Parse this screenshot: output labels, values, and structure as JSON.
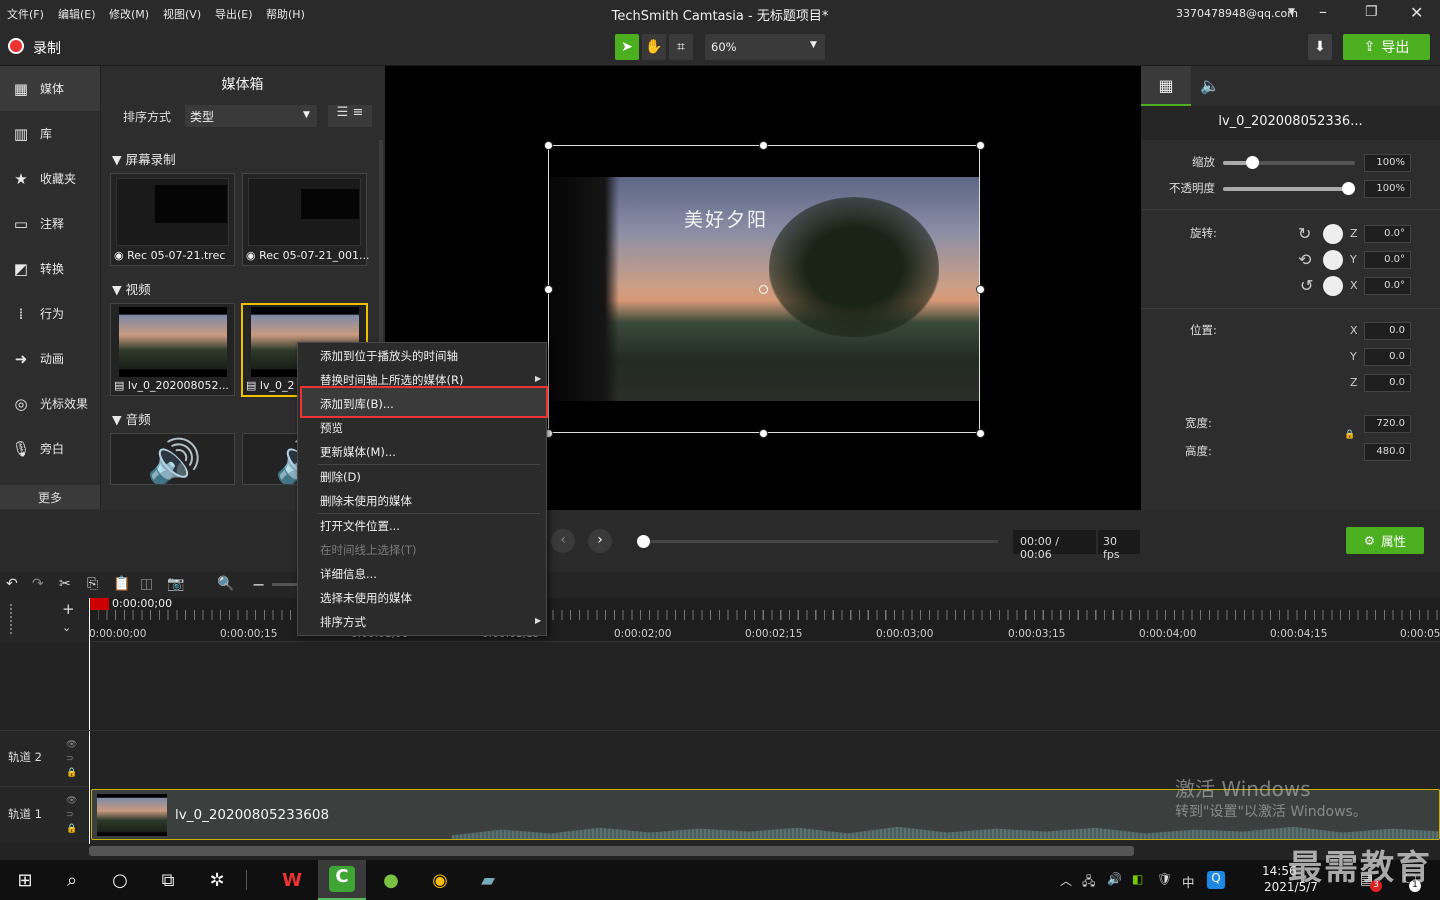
{
  "menubar": [
    "文件(F)",
    "编辑(E)",
    "修改(M)",
    "视图(V)",
    "导出(E)",
    "帮助(H)"
  ],
  "app_title": "TechSmith Camtasia - 无标题项目*",
  "account": "3370478948@qq.com",
  "toolbar": {
    "record_label": "录制",
    "zoom": "60%",
    "export_label": "导出"
  },
  "nav": [
    {
      "label": "媒体",
      "icon": "film-icon"
    },
    {
      "label": "库",
      "icon": "library-icon"
    },
    {
      "label": "收藏夹",
      "icon": "star-icon"
    },
    {
      "label": "注释",
      "icon": "annotation-icon"
    },
    {
      "label": "转换",
      "icon": "transition-icon"
    },
    {
      "label": "行为",
      "icon": "behavior-icon"
    },
    {
      "label": "动画",
      "icon": "animation-icon"
    },
    {
      "label": "光标效果",
      "icon": "cursor-effect-icon"
    },
    {
      "label": "旁白",
      "icon": "microphone-icon"
    }
  ],
  "nav_more": "更多",
  "bin": {
    "title": "媒体箱",
    "sort_label": "排序方式",
    "sort_value": "类型",
    "sections": {
      "screen": "屏幕录制",
      "video": "视频",
      "audio": "音频"
    },
    "screen_items": [
      "Rec 05-07-21.trec",
      "Rec 05-07-21_001..."
    ],
    "video_items": [
      "lv_0_202008052...",
      "lv_0_2"
    ]
  },
  "canvas": {
    "overlay_text": "美好夕阳"
  },
  "context_menu": [
    {
      "label": "添加到位于播放头的时间轴",
      "disabled": false
    },
    {
      "label": "替换时间轴上所选的媒体(R)",
      "disabled": false,
      "submenu": true
    },
    {
      "label": "添加到库(B)...",
      "disabled": false,
      "highlight": true
    },
    {
      "label": "预览",
      "disabled": false
    },
    {
      "label": "更新媒体(M)...",
      "disabled": false
    },
    {
      "label": "删除(D)",
      "disabled": false
    },
    {
      "label": "删除未使用的媒体",
      "disabled": false
    },
    {
      "label": "打开文件位置...",
      "disabled": false
    },
    {
      "label": "在时间线上选择(T)",
      "disabled": true
    },
    {
      "label": "详细信息...",
      "disabled": false
    },
    {
      "label": "选择未使用的媒体",
      "disabled": false
    },
    {
      "label": "排序方式",
      "disabled": false,
      "submenu": true
    }
  ],
  "props": {
    "clip_name": "lv_0_202008052336...",
    "scale_label": "缩放",
    "scale": "100%",
    "opacity_label": "不透明度",
    "opacity": "100%",
    "rotation_label": "旋转:",
    "rot_z": "0.0°",
    "rot_y": "0.0°",
    "rot_x": "0.0°",
    "position_label": "位置:",
    "pos_x": "0.0",
    "pos_y": "0.0",
    "pos_z": "0.0",
    "width_label": "宽度:",
    "width": "720.0",
    "height_label": "高度:",
    "height": "480.0",
    "axis_z": "Z",
    "axis_y": "Y",
    "axis_x": "X",
    "properties_button": "属性"
  },
  "playback": {
    "time": "00:00 / 00:06",
    "fps": "30 fps"
  },
  "timeline": {
    "playhead": "0:00:00;00",
    "ticks": [
      "0:00:00;00",
      "0:00:00;15",
      "0:00:01;00",
      "0:00:01;15",
      "0:00:02;00",
      "0:00:02;15",
      "0:00:03;00",
      "0:00:03;15",
      "0:00:04;00",
      "0:00:04;15",
      "0:00:05"
    ],
    "track2": "轨道 2",
    "track1": "轨道 1",
    "clip_name": "lv_0_20200805233608"
  },
  "watermark": {
    "line1": "激活 Windows",
    "line2": "转到\"设置\"以激活 Windows。",
    "brand": "最需教育"
  },
  "taskbar": {
    "time": "14:56",
    "date": "2021/5/7",
    "ime": "中",
    "badge": "3",
    "notif": "1"
  }
}
